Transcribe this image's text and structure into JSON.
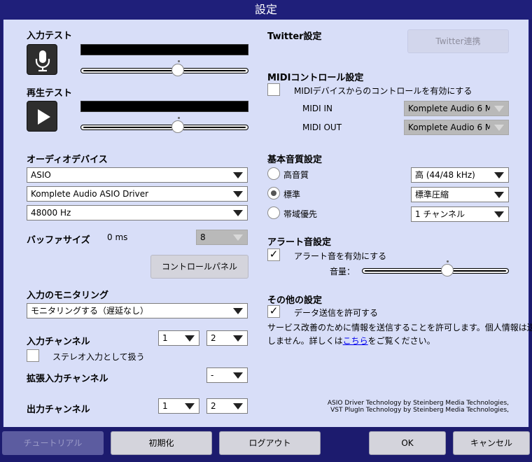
{
  "window": {
    "title": "設定"
  },
  "input_test": {
    "label": "入力テスト",
    "icon": "microphone-icon",
    "slider_value": 0.58
  },
  "playback_test": {
    "label": "再生テスト",
    "icon": "play-icon",
    "slider_value": 0.58
  },
  "audio_device": {
    "label": "オーディオデバイス",
    "driver_type": "ASIO",
    "driver": "Komplete Audio ASIO Driver",
    "sample_rate": "48000 Hz"
  },
  "buffer": {
    "label": "バッファサイズ",
    "value": "0 ms",
    "size": "8"
  },
  "control_panel": {
    "label": "コントロールパネル"
  },
  "monitoring": {
    "label": "入力のモニタリング",
    "value": "モニタリングする（遅延なし）"
  },
  "input_channel": {
    "label": "入力チャンネル",
    "ch1": "1",
    "ch2": "2",
    "stereo_label": "ステレオ入力として扱う",
    "stereo_checked": false
  },
  "extended_input": {
    "label": "拡張入力チャンネル",
    "value": "-"
  },
  "output_channel": {
    "label": "出力チャンネル",
    "ch1": "1",
    "ch2": "2"
  },
  "twitter": {
    "label": "Twitter設定",
    "button": "Twitter連携"
  },
  "midi": {
    "label": "MIDIコントロール設定",
    "enable_label": "MIDIデバイスからのコントロールを有効にする",
    "enable_checked": false,
    "in_label": "MIDI IN",
    "in_value": "Komplete Audio 6 M",
    "out_label": "MIDI OUT",
    "out_value": "Komplete Audio 6 M"
  },
  "quality": {
    "label": "基本音質設定",
    "options": [
      {
        "label": "高音質",
        "value": "高 (44/48 kHz)",
        "selected": false
      },
      {
        "label": "標準",
        "value": "標準圧縮",
        "selected": true
      },
      {
        "label": "帯域優先",
        "value": "1 チャンネル",
        "selected": false
      }
    ]
  },
  "alert": {
    "label": "アラート音設定",
    "enable_label": "アラート音を有効にする",
    "enable_checked": true,
    "volume_label": "音量：",
    "volume_value": 0.58
  },
  "other": {
    "label": "その他の設定",
    "send_label": "データ送信を許可する",
    "send_checked": true,
    "desc1": "サービス改善のために情報を送信することを許可します。個人情報は送信",
    "desc2a": "しません。詳しくは",
    "link": "こちら",
    "desc2b": "をご覧ください。"
  },
  "credits": {
    "line1": "ASIO Driver Technology by Steinberg Media Technologies,",
    "line2": "VST PlugIn Technology by Steinberg Media Technologies,"
  },
  "buttons": {
    "tutorial": "チュートリアル",
    "reset": "初期化",
    "logout": "ログアウト",
    "ok": "OK",
    "cancel": "キャンセル"
  }
}
